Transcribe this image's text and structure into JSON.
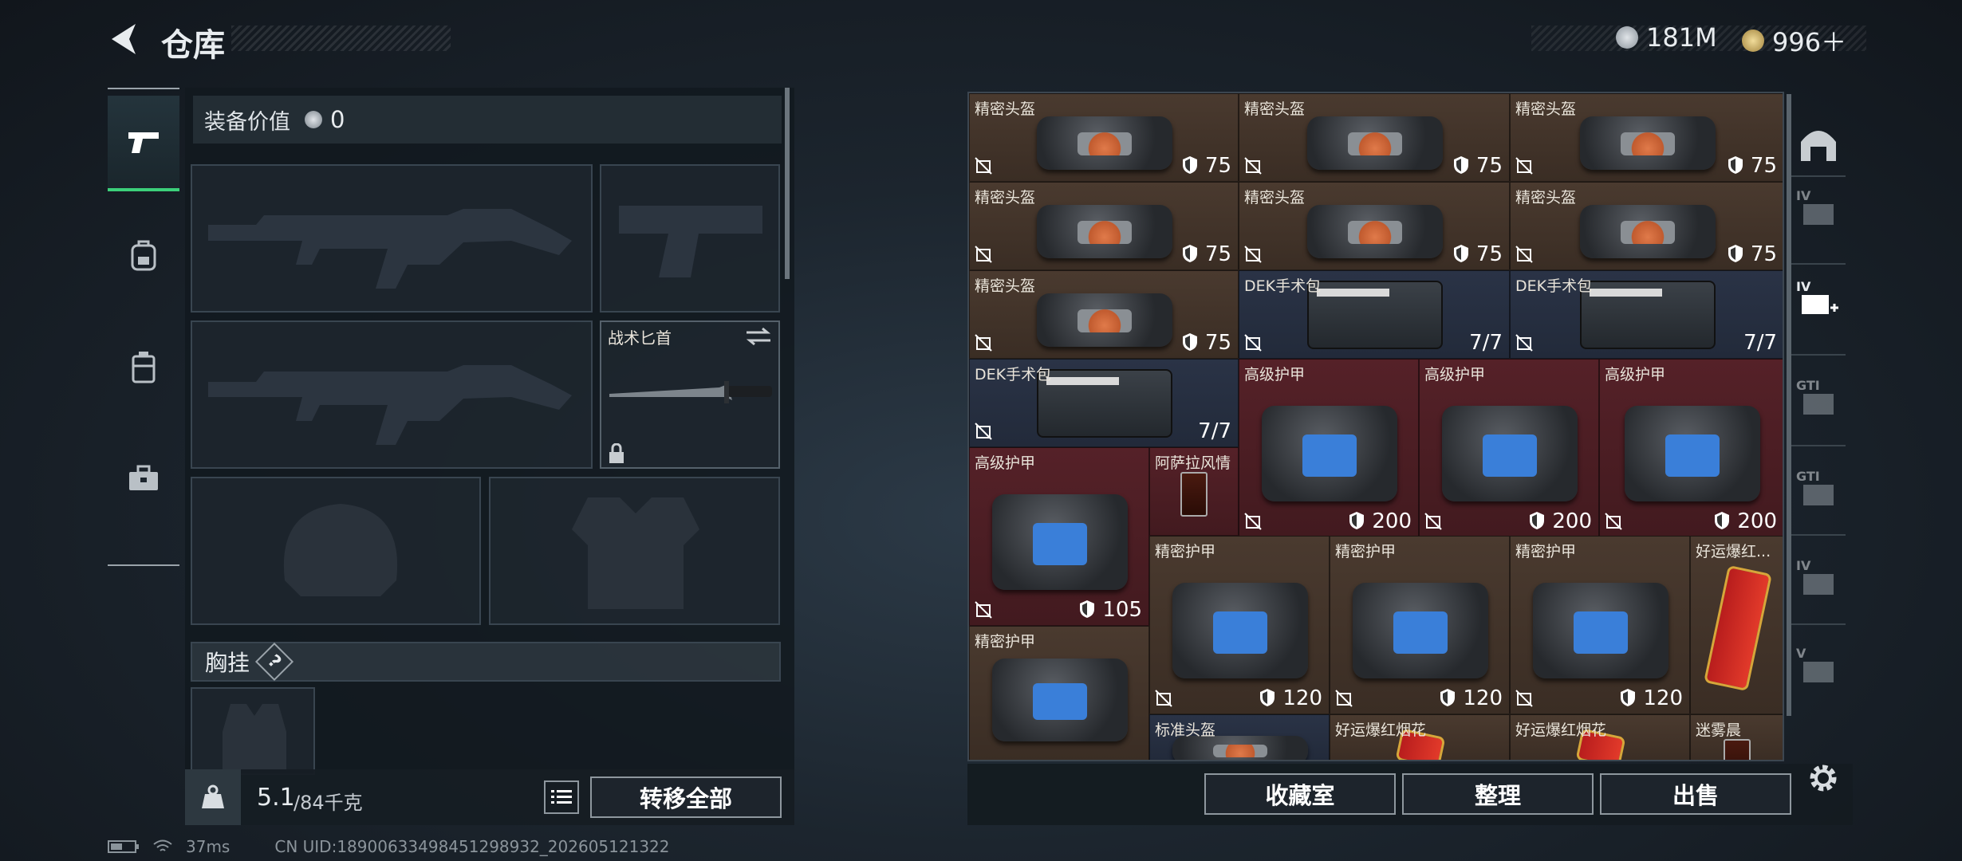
{
  "header": {
    "title": "仓库",
    "currency_silver": "181M",
    "currency_gold": "996＋"
  },
  "left_panel": {
    "value_label": "装备价值",
    "value_amount": "0",
    "knife_name": "战术匕首",
    "chest_rig_label": "胸挂",
    "chest_rig_help": "?",
    "weight_current": "5.1",
    "weight_max": "/84千克",
    "transfer_all": "转移全部"
  },
  "grid": {
    "items": [
      {
        "name": "精密头盔",
        "value": "75",
        "kind": "helmet"
      },
      {
        "name": "精密头盔",
        "value": "75",
        "kind": "helmet"
      },
      {
        "name": "精密头盔",
        "value": "75",
        "kind": "helmet"
      },
      {
        "name": "精密头盔",
        "value": "75",
        "kind": "helmet"
      },
      {
        "name": "精密头盔",
        "value": "75",
        "kind": "helmet"
      },
      {
        "name": "精密头盔",
        "value": "75",
        "kind": "helmet"
      },
      {
        "name": "精密头盔",
        "value": "75",
        "kind": "helmet"
      },
      {
        "name": "DEK手术包",
        "value": "7/7",
        "kind": "kit"
      },
      {
        "name": "DEK手术包",
        "value": "7/7",
        "kind": "kit"
      },
      {
        "name": "DEK手术包",
        "value": "7/7",
        "kind": "kit"
      },
      {
        "name": "高级护甲",
        "value": "200",
        "kind": "armor"
      },
      {
        "name": "高级护甲",
        "value": "200",
        "kind": "armor"
      },
      {
        "name": "高级护甲",
        "value": "200",
        "kind": "armor"
      },
      {
        "name": "高级护甲",
        "value": "105",
        "kind": "armor"
      },
      {
        "name": "阿萨拉风情",
        "value": "",
        "kind": "drink"
      },
      {
        "name": "精密护甲",
        "value": "120",
        "kind": "armor"
      },
      {
        "name": "精密护甲",
        "value": "120",
        "kind": "armor"
      },
      {
        "name": "精密护甲",
        "value": "120",
        "kind": "armor"
      },
      {
        "name": "好运爆红...",
        "value": "",
        "kind": "firework"
      },
      {
        "name": "精密护甲",
        "value": "",
        "kind": "armor"
      },
      {
        "name": "标准头盔",
        "value": "",
        "kind": "helmet"
      },
      {
        "name": "好运爆红烟花",
        "value": "",
        "kind": "firework"
      },
      {
        "name": "好运爆红烟花",
        "value": "",
        "kind": "firework"
      },
      {
        "name": "迷雾晨",
        "value": "",
        "kind": "drink"
      }
    ]
  },
  "bottom_buttons": {
    "collection": "收藏室",
    "sort": "整理",
    "sell": "出售"
  },
  "right_nav": {
    "labels": [
      "IV",
      "IV",
      "GTI",
      "GTI",
      "IV",
      "V"
    ]
  },
  "status_bar": {
    "ping": "37ms",
    "uid": "CN UID:18900633498451298932_202605121322"
  },
  "colors": {
    "accent_green": "#3cd07a",
    "brown": "#4a3a2f",
    "red": "#552128",
    "navy": "#2a3346"
  }
}
